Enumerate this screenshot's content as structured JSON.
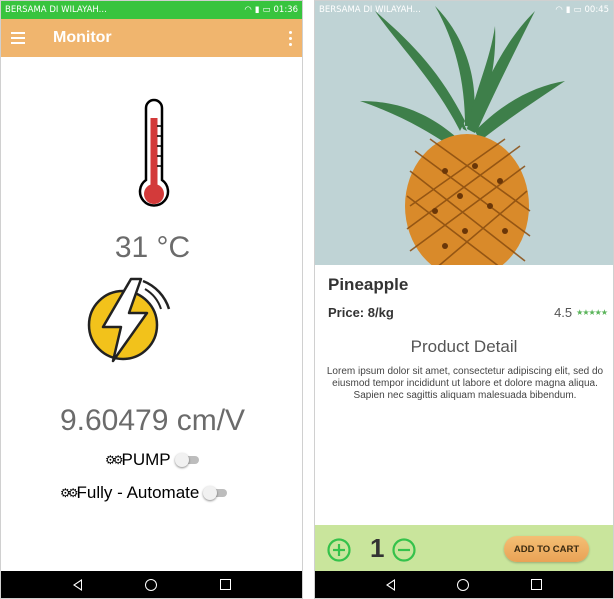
{
  "monitor_app": {
    "status_bar": {
      "carrier": "BERSAMA DI WILAYAH...",
      "time": "01:36"
    },
    "title": "Monitor",
    "temperature": "31 °C",
    "ratio": "9.60479 cm/V",
    "pump_label": "PUMP",
    "pump_on": false,
    "automate_label": "Fully - Automate",
    "automate_on": false
  },
  "shop_app": {
    "status_bar": {
      "carrier": "BERSAMA DI WILAYAH...",
      "time": "00:45"
    },
    "product_name": "Pineapple",
    "price": "Price: 8/kg",
    "rating": "4.5",
    "stars": "★★★★★",
    "detail_title": "Product Detail",
    "detail_text": "Lorem ipsum dolor sit amet, consectetur adipiscing elit, sed do eiusmod tempor incididunt ut labore et dolore magna aliqua. Sapien nec sagittis aliquam malesuada bibendum.",
    "quantity": "1",
    "add_to_cart": "ADD TO CART"
  },
  "colors": {
    "status_green": "#38c43e",
    "appbar_orange": "#f0b56e",
    "thermo_red": "#d33a3a",
    "bolt_yellow": "#f2c21b",
    "footer_green": "#c9e59c",
    "qty_icon_green": "#35c24b",
    "cart_orange": "#eda95e"
  }
}
